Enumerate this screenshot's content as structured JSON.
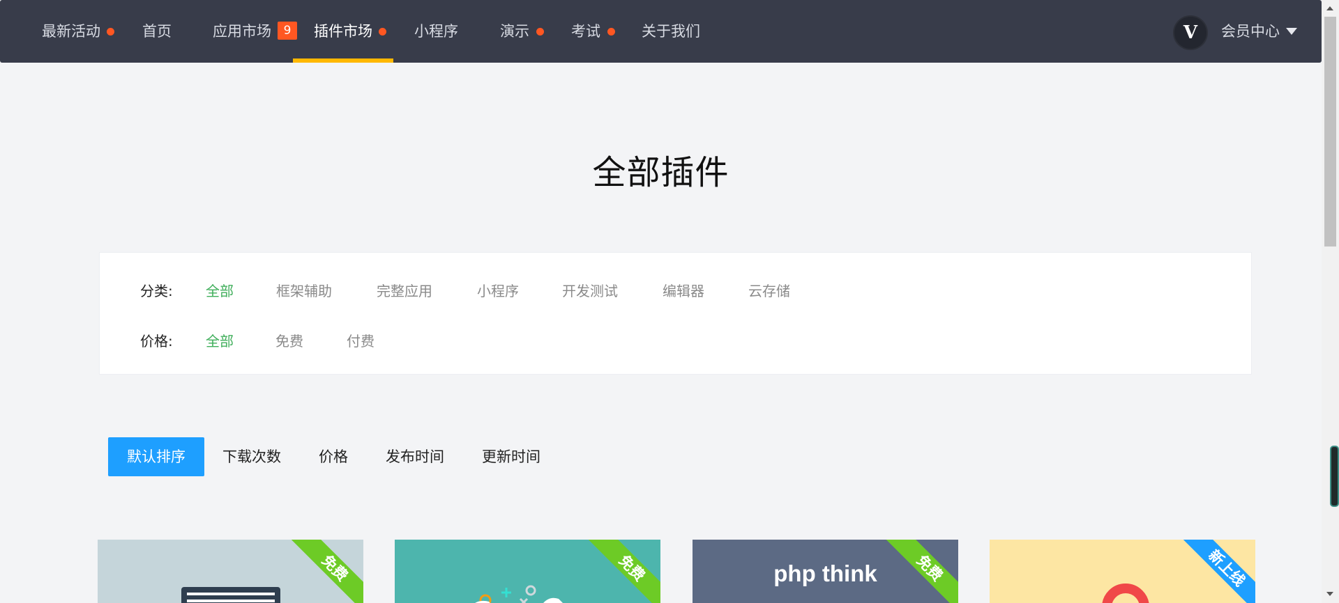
{
  "nav": {
    "items": [
      {
        "label": "最新活动",
        "dot": true
      },
      {
        "label": "首页"
      },
      {
        "label": "应用市场",
        "badge": "9"
      },
      {
        "label": "插件市场",
        "dot": true,
        "active": true
      },
      {
        "label": "小程序"
      },
      {
        "label": "演示",
        "dot": true
      },
      {
        "label": "考试",
        "dot": true
      },
      {
        "label": "关于我们"
      }
    ],
    "avatar_letter": "V",
    "member_label": "会员中心"
  },
  "page_title": "全部插件",
  "filters": {
    "category": {
      "label": "分类:",
      "options": [
        "全部",
        "框架辅助",
        "完整应用",
        "小程序",
        "开发测试",
        "编辑器",
        "云存储"
      ],
      "selected": "全部"
    },
    "price": {
      "label": "价格:",
      "options": [
        "全部",
        "免费",
        "付费"
      ],
      "selected": "全部"
    }
  },
  "sort": {
    "options": [
      "默认排序",
      "下载次数",
      "价格",
      "发布时间",
      "更新时间"
    ],
    "selected": "默认排序"
  },
  "cards": [
    {
      "ribbon": "免费",
      "ribbon_color": "#6dcb26",
      "bg": "#c5d5da",
      "text": ""
    },
    {
      "ribbon": "免费",
      "ribbon_color": "#6dcb26",
      "bg": "#4db5ad",
      "text": ""
    },
    {
      "ribbon": "免费",
      "ribbon_color": "#6dcb26",
      "bg": "#5c6a84",
      "text": "php think"
    },
    {
      "ribbon": "新上线",
      "ribbon_color": "#1e9fff",
      "bg": "#fde6a3",
      "text": ""
    }
  ],
  "colors": {
    "nav_bg": "#383c4a",
    "active_underline": "#ffb800",
    "badge": "#ff5722",
    "selected_filter": "#3fae5a",
    "primary_button": "#1e9fff"
  }
}
